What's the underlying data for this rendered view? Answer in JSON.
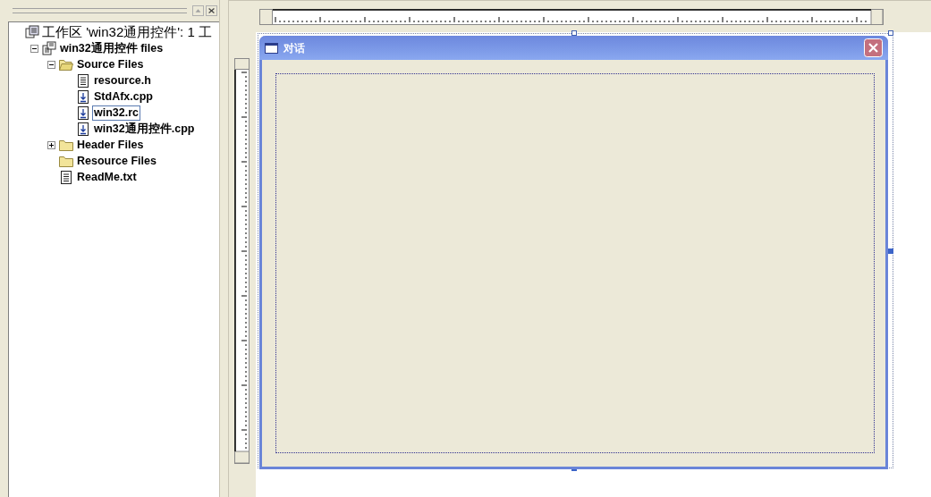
{
  "workspace_tree": {
    "label": "工作区 'win32通用控件': 1 工",
    "kind": "workspace",
    "children": [
      {
        "label": "win32通用控件 files",
        "kind": "project",
        "expanded": true,
        "selected": false,
        "children": [
          {
            "label": "Source Files",
            "kind": "folder",
            "expanded": true,
            "selected": false,
            "children": [
              {
                "label": "resource.h",
                "kind": "header",
                "selected": false
              },
              {
                "label": "StdAfx.cpp",
                "kind": "source",
                "selected": false
              },
              {
                "label": "win32.rc",
                "kind": "source",
                "selected": true
              },
              {
                "label": "win32通用控件.cpp",
                "kind": "source",
                "selected": false
              }
            ]
          },
          {
            "label": "Header Files",
            "kind": "folder",
            "expanded": false,
            "selected": false
          },
          {
            "label": "Resource Files",
            "kind": "folder",
            "selected": false
          },
          {
            "label": "ReadMe.txt",
            "kind": "header",
            "selected": false
          }
        ]
      }
    ]
  },
  "dialog": {
    "title": "对话"
  }
}
